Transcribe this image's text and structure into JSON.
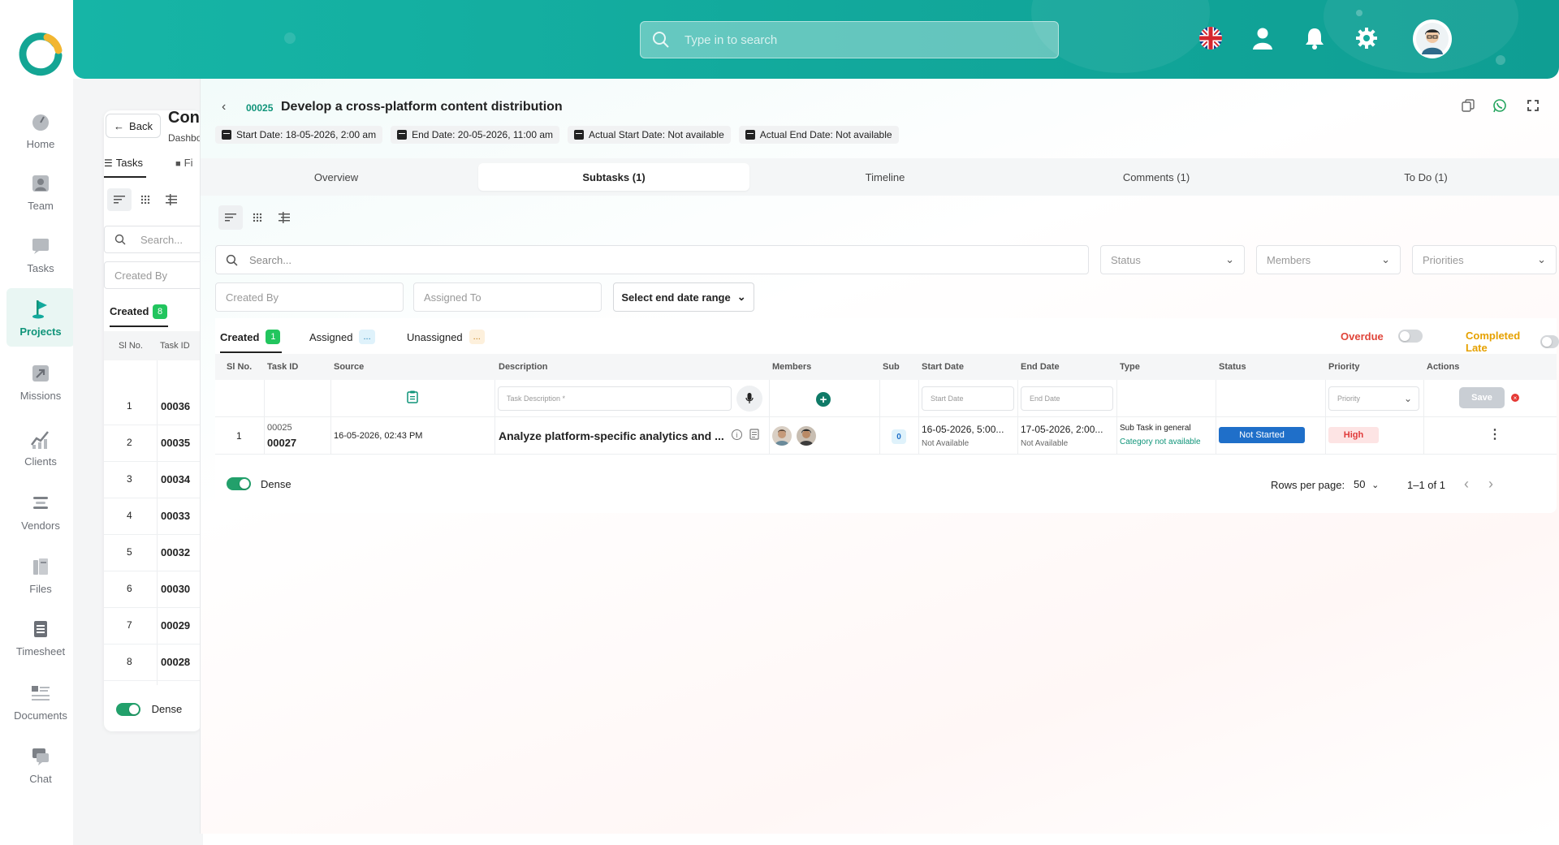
{
  "sidebar": {
    "items": [
      {
        "label": "Home",
        "icon": "home-icon"
      },
      {
        "label": "Team",
        "icon": "team-icon"
      },
      {
        "label": "Tasks",
        "icon": "tasks-icon"
      },
      {
        "label": "Projects",
        "icon": "flag-icon"
      },
      {
        "label": "Missions",
        "icon": "missions-icon"
      },
      {
        "label": "Clients",
        "icon": "chart-icon"
      },
      {
        "label": "Vendors",
        "icon": "vendors-icon"
      },
      {
        "label": "Files",
        "icon": "files-icon"
      },
      {
        "label": "Timesheet",
        "icon": "timesheet-icon"
      },
      {
        "label": "Documents",
        "icon": "documents-icon"
      },
      {
        "label": "Chat",
        "icon": "chat-icon"
      }
    ],
    "active": "Projects"
  },
  "header": {
    "search_placeholder": "Type in to search"
  },
  "background_panel": {
    "back_label": "Back",
    "title": "Con",
    "subtitle": "Dashbo",
    "tab_tasks": "Tasks",
    "tab_files": "Fi",
    "search_placeholder": "Search...",
    "created_by_placeholder": "Created By",
    "created_label": "Created",
    "created_count": "8",
    "col_sl": "Sl No.",
    "col_task": "Task ID",
    "rows": [
      {
        "n": "1",
        "id": "00036"
      },
      {
        "n": "2",
        "id": "00035"
      },
      {
        "n": "3",
        "id": "00034"
      },
      {
        "n": "4",
        "id": "00033"
      },
      {
        "n": "5",
        "id": "00032"
      },
      {
        "n": "6",
        "id": "00030"
      },
      {
        "n": "7",
        "id": "00029"
      },
      {
        "n": "8",
        "id": "00028"
      }
    ],
    "dense_label": "Dense"
  },
  "task": {
    "code": "00025",
    "title": "Develop a cross-platform content distribution",
    "chips": [
      "Start Date: 18-05-2026, 2:00 am",
      "End Date: 20-05-2026, 11:00 am",
      "Actual Start Date: Not available",
      "Actual End Date: Not available"
    ]
  },
  "tabs": [
    "Overview",
    "Subtasks (1)",
    "Timeline",
    "Comments (1)",
    "To Do (1)"
  ],
  "filters": {
    "search_placeholder": "Search...",
    "status": "Status",
    "members": "Members",
    "priorities": "Priorities",
    "created_by": "Created By",
    "assigned_to": "Assigned To",
    "date_range": "Select end date range"
  },
  "subtabs": {
    "created": "Created",
    "created_count": "1",
    "assigned": "Assigned",
    "assigned_count": "...",
    "unassigned": "Unassigned",
    "unassigned_count": "...",
    "overdue": "Overdue",
    "completed_late": "Completed Late"
  },
  "table": {
    "headers": [
      "Sl No.",
      "Task ID",
      "Source",
      "Description",
      "Members",
      "Sub",
      "Start Date",
      "End Date",
      "Type",
      "Status",
      "Priority",
      "Actions"
    ],
    "new_row": {
      "desc_placeholder": "Task Description *",
      "start_placeholder": "Start Date",
      "end_placeholder": "End Date",
      "priority_placeholder": "Priority",
      "save_label": "Save"
    },
    "rows": [
      {
        "sl": "1",
        "parent_id": "00025",
        "task_id": "00027",
        "source": "16-05-2026, 02:43 PM",
        "description": "Analyze platform-specific analytics and ...",
        "sub": "0",
        "start": "16-05-2026, 5:00...",
        "start_actual": "Not Available",
        "end": "17-05-2026, 2:00...",
        "end_actual": "Not Available",
        "type": "Sub Task in general",
        "category": "Category not available",
        "status": "Not Started",
        "priority": "High"
      }
    ]
  },
  "footer": {
    "dense_label": "Dense",
    "rows_per_page_label": "Rows per page:",
    "rows_per_page": "50",
    "range": "1–1 of 1"
  },
  "colors": {
    "brand": "#16b5a6",
    "accent_green": "#0f9479",
    "status_blue": "#1f6fc9",
    "priority_red": "#e03a3a",
    "overdue": "#e0453a",
    "completed_late": "#e6a100"
  }
}
